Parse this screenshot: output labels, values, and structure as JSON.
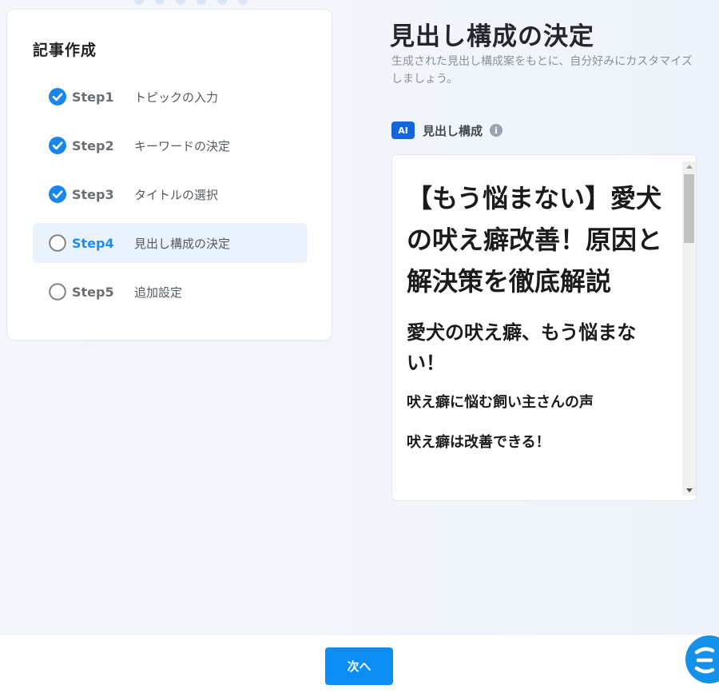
{
  "steps_panel": {
    "title": "記事作成",
    "steps": [
      {
        "label": "Step1",
        "name": "トピックの入力",
        "status": "done"
      },
      {
        "label": "Step2",
        "name": "キーワードの決定",
        "status": "done"
      },
      {
        "label": "Step3",
        "name": "タイトルの選択",
        "status": "done"
      },
      {
        "label": "Step4",
        "name": "見出し構成の決定",
        "status": "current"
      },
      {
        "label": "Step5",
        "name": "追加設定",
        "status": "pending"
      }
    ]
  },
  "main": {
    "title": "見出し構成の決定",
    "subtitle": "生成された見出し構成案をもとに、自分好みにカスタマイズしましょう。",
    "section": {
      "badge": "AI",
      "label": "見出し構成",
      "info_icon": "i"
    },
    "editor": {
      "h1": "【もう悩まない】愛犬の吠え癖改善！原因と解決策を徹底解説",
      "h2": "愛犬の吠え癖、もう悩まない！",
      "h3_1": "吠え癖に悩む飼い主さんの声",
      "h3_2": "吠え癖は改善できる！"
    }
  },
  "footer": {
    "next_label": "次へ"
  },
  "colors": {
    "accent": "#1c8df0",
    "check": "#1a86ec",
    "button": "#0a8ef5",
    "ai_badge": "#1565d8"
  }
}
